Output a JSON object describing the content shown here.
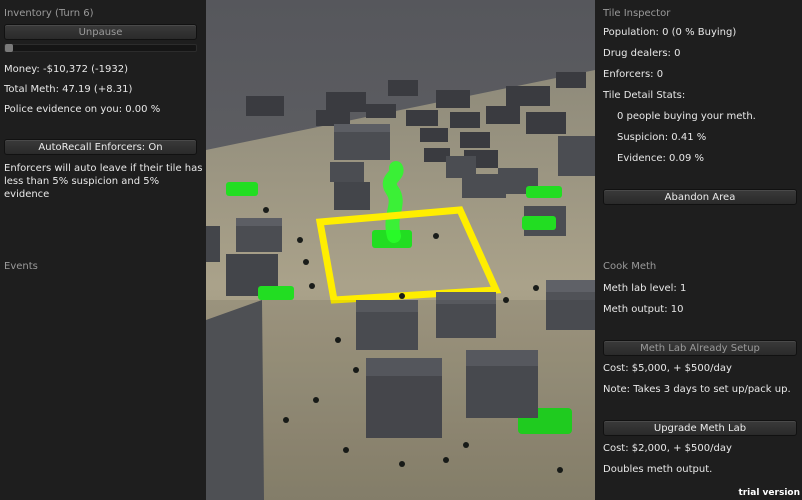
{
  "left": {
    "inventory_title": "Inventory (Turn 6)",
    "unpause_label": "Unpause",
    "money": "Money: -$10,372 (-1932)",
    "total_meth": "Total Meth: 47.19 (+8.31)",
    "police_evidence": "Police evidence on you: 0.00 %",
    "autorecall_label": "AutoRecall Enforcers: On",
    "autorecall_note": "Enforcers will auto leave if their tile has less than 5% suspicion and 5% evidence",
    "events_title": "Events"
  },
  "right": {
    "tile_inspector_title": "Tile Inspector",
    "population": "Population: 0 (0 % Buying)",
    "drug_dealers": "Drug dealers: 0",
    "enforcers": "Enforcers: 0",
    "tile_detail_stats": "Tile Detail Stats:",
    "people_buying": "0 people buying your meth.",
    "suspicion": "Suspicion: 0.41 %",
    "evidence": "Evidence: 0.09 %",
    "abandon_label": "Abandon Area",
    "cook_meth_title": "Cook Meth",
    "meth_lab_level": "Meth lab level: 1",
    "meth_output": "Meth output: 10",
    "lab_setup_label": "Meth Lab Already Setup",
    "lab_cost": "Cost: $5,000, + $500/day",
    "lab_note": "Note: Takes 3 days to set up/pack up.",
    "upgrade_label": "Upgrade Meth Lab",
    "upgrade_cost": "Cost: $2,000, + $500/day",
    "upgrade_note": "Doubles meth output."
  },
  "footer": {
    "trial": "trial version"
  },
  "colors": {
    "highlight": "#ffee00",
    "meth_green": "#22dd22",
    "ground": "#aaa28a",
    "building": "#4b4d52"
  }
}
